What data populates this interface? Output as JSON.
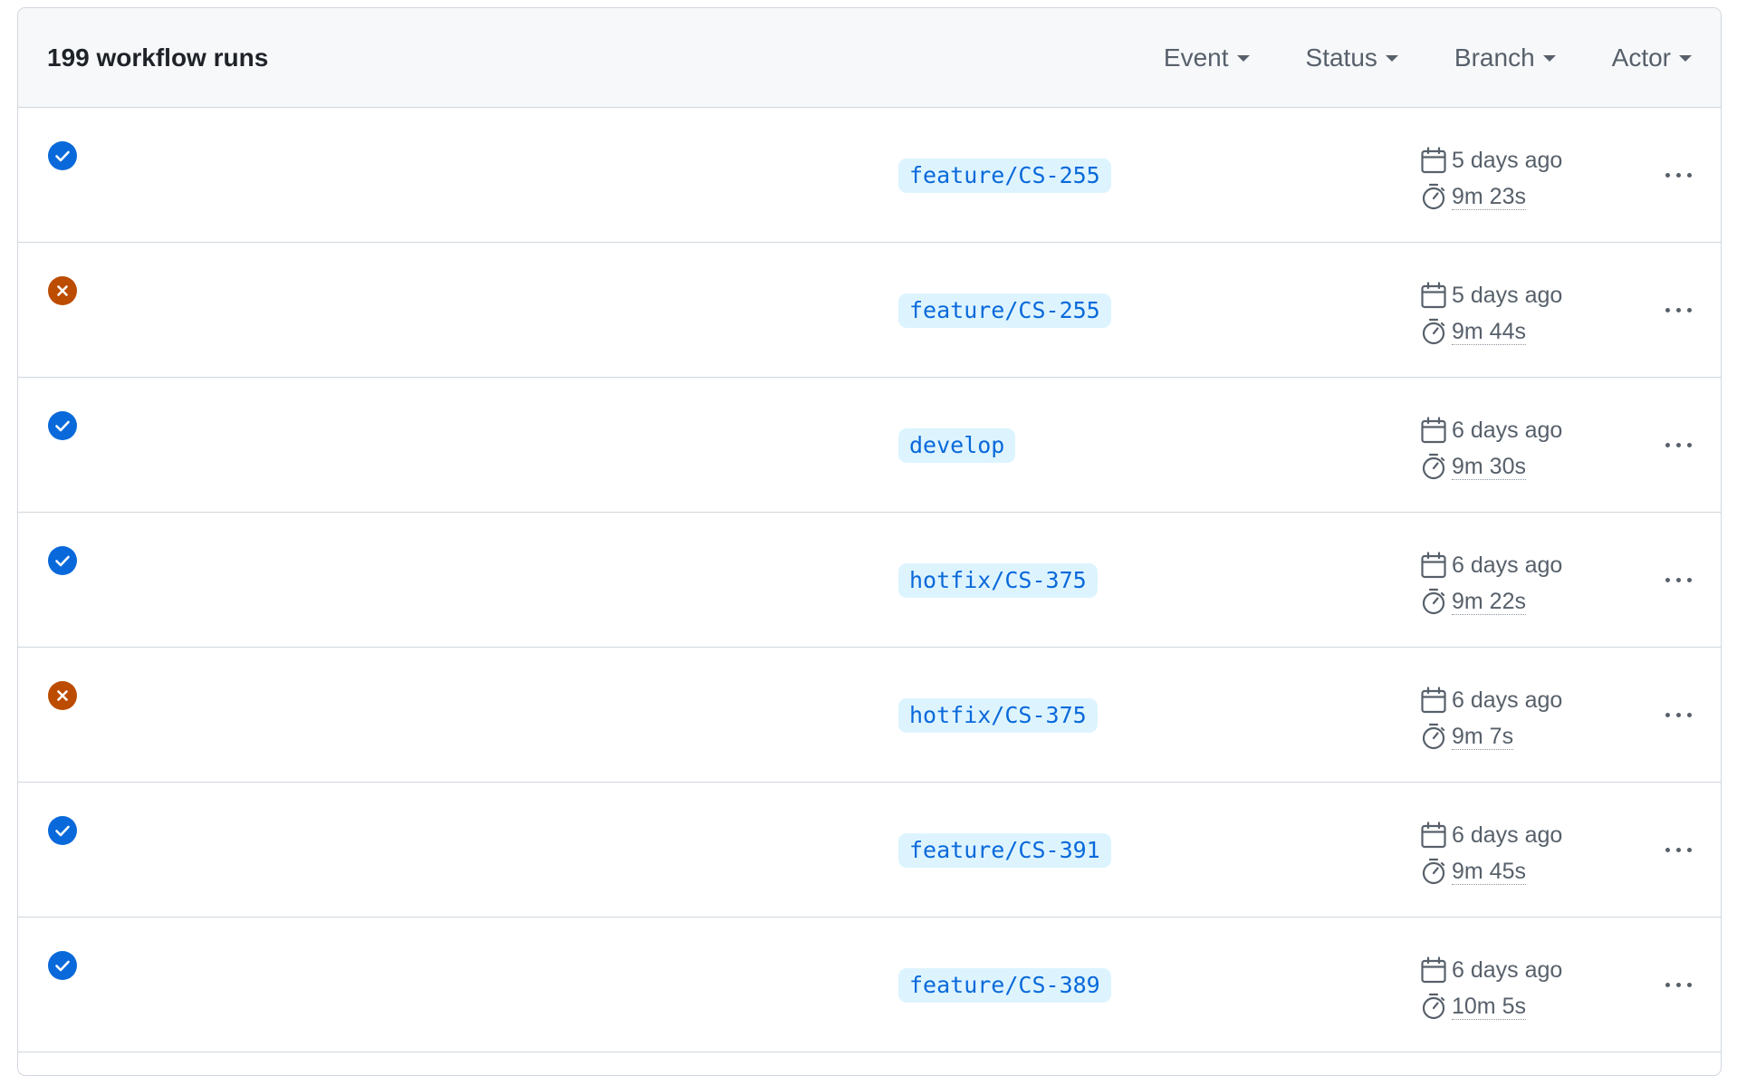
{
  "header": {
    "runs_count": "199 workflow runs",
    "filters": [
      "Event",
      "Status",
      "Branch",
      "Actor"
    ]
  },
  "colors": {
    "success": "#0969da",
    "failure": "#bc4c00",
    "branch_bg": "#ddf4ff",
    "branch_text": "#0969da"
  },
  "runs": [
    {
      "status": "success",
      "status_icon": "check-circle-icon",
      "branch": "feature/CS-255",
      "date": "5 days ago",
      "duration": "9m 23s"
    },
    {
      "status": "failure",
      "status_icon": "x-circle-icon",
      "branch": "feature/CS-255",
      "date": "5 days ago",
      "duration": "9m 44s"
    },
    {
      "status": "success",
      "status_icon": "check-circle-icon",
      "branch": "develop",
      "date": "6 days ago",
      "duration": "9m 30s"
    },
    {
      "status": "success",
      "status_icon": "check-circle-icon",
      "branch": "hotfix/CS-375",
      "date": "6 days ago",
      "duration": "9m 22s"
    },
    {
      "status": "failure",
      "status_icon": "x-circle-icon",
      "branch": "hotfix/CS-375",
      "date": "6 days ago",
      "duration": "9m 7s"
    },
    {
      "status": "success",
      "status_icon": "check-circle-icon",
      "branch": "feature/CS-391",
      "date": "6 days ago",
      "duration": "9m 45s"
    },
    {
      "status": "success",
      "status_icon": "check-circle-icon",
      "branch": "feature/CS-389",
      "date": "6 days ago",
      "duration": "10m 5s"
    }
  ]
}
